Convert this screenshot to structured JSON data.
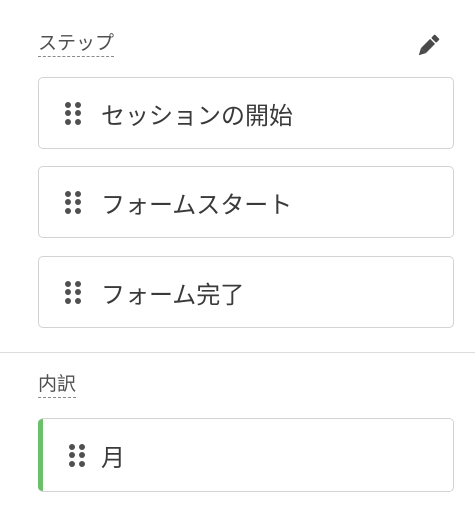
{
  "steps": {
    "label": "ステップ",
    "edit_icon": "pencil-icon",
    "items": [
      {
        "label": "セッションの開始"
      },
      {
        "label": "フォームスタート"
      },
      {
        "label": "フォーム完了"
      }
    ]
  },
  "breakdown": {
    "label": "内訳",
    "accent_color": "#6abf69",
    "items": [
      {
        "label": "月"
      }
    ]
  },
  "colors": {
    "border": "#d3d3d3",
    "divider": "#dcdcdc",
    "text": "#3a3a3a"
  }
}
